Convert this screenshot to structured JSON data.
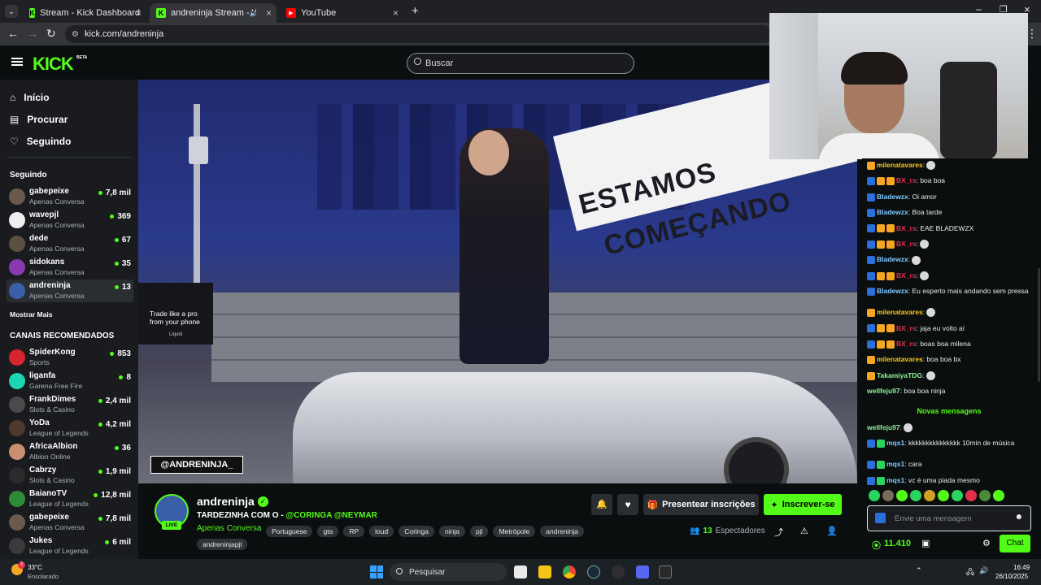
{
  "tabs": [
    {
      "title": "Stream - Kick Dashboard",
      "icon": "kick-icon"
    },
    {
      "title": "andreninja Stream - Watch",
      "icon": "kick-icon"
    },
    {
      "title": "YouTube",
      "icon": "youtube-icon"
    }
  ],
  "url": "kick.com/andreninja",
  "search_placeholder": "Buscar",
  "logo": "KICK",
  "logo_badge": "BETA",
  "nav": [
    {
      "label": "Início",
      "icon": "home-icon"
    },
    {
      "label": "Procurar",
      "icon": "browse-icon"
    },
    {
      "label": "Seguindo",
      "icon": "heart-icon"
    }
  ],
  "following_title": "Seguindo",
  "following": [
    {
      "name": "gabepeixe",
      "category": "Apenas Conversa",
      "viewers": "7,8 mil"
    },
    {
      "name": "wavepjl",
      "category": "Apenas Conversa",
      "viewers": "369"
    },
    {
      "name": "dede",
      "category": "Apenas Conversa",
      "viewers": "67"
    },
    {
      "name": "sidokans",
      "category": "Apenas Conversa",
      "viewers": "35"
    },
    {
      "name": "andreninja",
      "category": "Apenas Conversa",
      "viewers": "13"
    }
  ],
  "show_more": "Mostrar Mais",
  "recommended_title": "CANAIS RECOMENDADOS",
  "recommended": [
    {
      "name": "SpiderKong",
      "category": "Sports",
      "viewers": "853"
    },
    {
      "name": "liganfa",
      "category": "Garena Free Fire",
      "viewers": "8"
    },
    {
      "name": "FrankDimes",
      "category": "Slots & Casino",
      "viewers": "2,4 mil"
    },
    {
      "name": "YoDa",
      "category": "League of Legends",
      "viewers": "4,2 mil"
    },
    {
      "name": "AfricaAlbion",
      "category": "Albion Online",
      "viewers": "36"
    },
    {
      "name": "Cabrzy",
      "category": "Slots & Casino",
      "viewers": "1,9 mil"
    },
    {
      "name": "BaianoTV",
      "category": "League of Legends",
      "viewers": "12,8 mil"
    },
    {
      "name": "gabepeixe",
      "category": "Apenas Conversa",
      "viewers": "7,8 mil"
    },
    {
      "name": "Jukes",
      "category": "League of Legends",
      "viewers": "6 mil"
    }
  ],
  "video": {
    "overlay_text_1": "ESTAMOS",
    "overlay_text_2": "COMEÇANDO",
    "handle": "@ANDRENINJA_",
    "ad_line1": "Trade like a pro",
    "ad_line2": "from your phone",
    "ad_brand": "Liquid"
  },
  "streamer": {
    "name": "andreninja",
    "live_label": "LIVE",
    "title_prefix": "TARDEZINHA COM O - ",
    "title_mentions": "@CORINGA @NEYMAR",
    "category": "Apenas Conversa",
    "tags": [
      "Portuguese",
      "gta",
      "RP",
      "loud",
      "Coringa",
      "ninja",
      "pjl",
      "Metrópole",
      "andreninja",
      "andreninjapjl"
    ],
    "viewers": "13",
    "viewers_label": "Espectadores"
  },
  "buttons": {
    "gift": "Presentear inscrições",
    "subscribe": "Inscrever-se",
    "chat": "Chat"
  },
  "chat": {
    "messages": [
      {
        "user": "milenatavares",
        "text": "",
        "color": "#f5c518",
        "badges": [
          "#f5a623"
        ]
      },
      {
        "user": "BX_rs",
        "text": "boa boa",
        "color": "#e0304a",
        "badges": [
          "#2a6fdb",
          "#f5a623",
          "#f5a623"
        ]
      },
      {
        "user": "Bladewzx",
        "text": "Oi amor",
        "color": "#7ec9ff",
        "badges": [
          "#2a6fdb"
        ]
      },
      {
        "user": "Bladewzx",
        "text": "Boa tarde",
        "color": "#7ec9ff",
        "badges": [
          "#2a6fdb"
        ]
      },
      {
        "user": "BX_rs",
        "text": "EAE BLADEWZX",
        "color": "#e0304a",
        "badges": [
          "#2a6fdb",
          "#f5a623",
          "#f5a623"
        ]
      },
      {
        "user": "BX_rs",
        "text": "",
        "color": "#e0304a",
        "badges": [
          "#2a6fdb",
          "#f5a623",
          "#f5a623"
        ]
      },
      {
        "user": "Bladewzx",
        "text": "",
        "color": "#7ec9ff",
        "badges": [
          "#2a6fdb"
        ]
      },
      {
        "user": "BX_rs",
        "text": "",
        "color": "#e0304a",
        "badges": [
          "#2a6fdb",
          "#f5a623",
          "#f5a623"
        ]
      },
      {
        "user": "Bladewzx",
        "text": "Eu esperto mais andando sem pressa",
        "color": "#7ec9ff",
        "badges": [
          "#2a6fdb"
        ]
      },
      {
        "user": "milenatavares",
        "text": "",
        "color": "#f5c518",
        "badges": [
          "#f5a623"
        ]
      },
      {
        "user": "BX_rs",
        "text": "jaja eu volto aí",
        "color": "#e0304a",
        "badges": [
          "#2a6fdb",
          "#f5a623",
          "#f5a623"
        ]
      },
      {
        "user": "BX_rs",
        "text": "boas boa milena",
        "color": "#e0304a",
        "badges": [
          "#2a6fdb",
          "#f5a623",
          "#f5a623"
        ]
      },
      {
        "user": "milenatavares",
        "text": "boa boa bx",
        "color": "#f5c518",
        "badges": [
          "#f5a623"
        ]
      },
      {
        "user": "TakamiyaTDG",
        "text": "",
        "color": "#8ef59b",
        "badges": [
          "#f5a623"
        ]
      },
      {
        "user": "wellfeju97",
        "text": "boa boa ninja",
        "color": "#8ef59b",
        "badges": []
      }
    ],
    "new_messages_label": "Novas mensagens",
    "new_messages": [
      {
        "user": "wellfeju97",
        "text": "",
        "color": "#8ef59b",
        "badges": []
      },
      {
        "user": "mqs1",
        "text": "kkkkkkkkkkkkkkk 10min de música",
        "color": "#7ec9ff",
        "badges": [
          "#2a6fdb",
          "#2bd45f"
        ]
      },
      {
        "user": "mqs1",
        "text": "cara",
        "color": "#7ec9ff",
        "badges": [
          "#2a6fdb",
          "#2bd45f"
        ]
      },
      {
        "user": "mqs1",
        "text": "vc é uma piada mesmo",
        "color": "#7ec9ff",
        "badges": [
          "#2a6fdb",
          "#2bd45f"
        ]
      }
    ],
    "input_placeholder": "Envie uma mensagem",
    "points": "11.410"
  },
  "taskbar": {
    "weather_temp": "33°C",
    "weather_desc": "Ensolarado",
    "weather_badge": "3",
    "search_placeholder": "Pesquisar",
    "time": "16:49",
    "date": "26/10/2025"
  },
  "colors": {
    "kick_green": "#53fc18",
    "bg": "#0b0e0f",
    "sidebar": "#191b1f"
  }
}
